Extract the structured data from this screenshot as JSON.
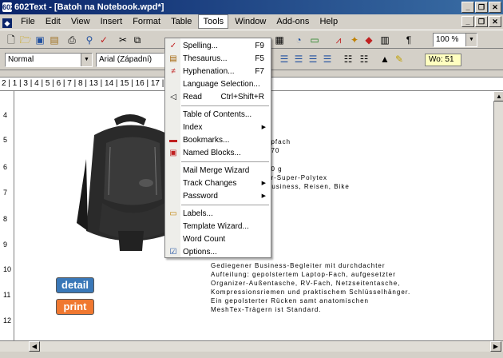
{
  "window": {
    "app_icon": "602",
    "title": "602Text - [Batoh na Notebook.wpd*]"
  },
  "menubar": {
    "items": [
      "File",
      "Edit",
      "View",
      "Insert",
      "Format",
      "Table",
      "Tools",
      "Window",
      "Add-ons",
      "Help"
    ],
    "active": "Tools"
  },
  "toolbar2": {
    "style_value": "Normal",
    "font_value": "Arial (Západní)",
    "zoom_value": "100 %",
    "word_count": "Wo: 51"
  },
  "ruler": {
    "text": "2 | 1 | 3 | 4 | 5 | 6 | 7 | 8 | 13 | 14 | 15 | 16 | 17 | 18 | 19 | 20 | 21"
  },
  "vruler": [
    "4",
    "5",
    "6",
    "7",
    "8",
    "9",
    "10",
    "11",
    "12"
  ],
  "document": {
    "partial_lines": [
      "opfach",
      "070",
      "50 g",
      "er-Super-Polytex",
      "Business, Reisen, Bike"
    ],
    "paragraph": [
      "Gediegener Business-Begleiter mit durchdachter",
      "Aufteilung: gepolstertem Laptop-Fach, aufgesetzter",
      "Organizer-Außentasche, RV-Fach, Netzseitentasche,",
      "Kompressionsriemen und praktischem Schlüsselhänger.",
      "Ein gepolsterter Rücken samt anatomischen",
      "MeshTex-Trägern ist Standard."
    ],
    "detail_button": "detail",
    "print_button": "print",
    "detail_color": "#3a78b8",
    "print_color": "#f07830"
  },
  "tools_menu": {
    "items": [
      {
        "label": "Spelling...",
        "shortcut": "F9",
        "icon": "spellcheck-icon"
      },
      {
        "label": "Thesaurus...",
        "shortcut": "F5",
        "icon": "book-icon"
      },
      {
        "label": "Hyphenation...",
        "shortcut": "F7",
        "icon": "hyphen-icon"
      },
      {
        "label": "Language Selection...",
        "shortcut": "",
        "icon": ""
      },
      {
        "label": "Read",
        "shortcut": "Ctrl+Shift+R",
        "icon": "speaker-icon"
      },
      {
        "label": "Table of Contents...",
        "shortcut": "",
        "icon": ""
      },
      {
        "label": "Index",
        "shortcut": "",
        "icon": "",
        "submenu": true
      },
      {
        "label": "Bookmarks...",
        "shortcut": "",
        "icon": "bookmark-icon"
      },
      {
        "label": "Named Blocks...",
        "shortcut": "",
        "icon": "named-block-icon"
      },
      {
        "label": "Mail Merge Wizard",
        "shortcut": "",
        "icon": ""
      },
      {
        "label": "Track Changes",
        "shortcut": "",
        "icon": "",
        "submenu": true
      },
      {
        "label": "Password",
        "shortcut": "",
        "icon": "",
        "submenu": true
      },
      {
        "label": "Labels...",
        "shortcut": "",
        "icon": "label-icon"
      },
      {
        "label": "Template Wizard...",
        "shortcut": "",
        "icon": ""
      },
      {
        "label": "Word Count",
        "shortcut": "",
        "icon": ""
      },
      {
        "label": "Options...",
        "shortcut": "",
        "icon": "options-icon"
      }
    ]
  }
}
